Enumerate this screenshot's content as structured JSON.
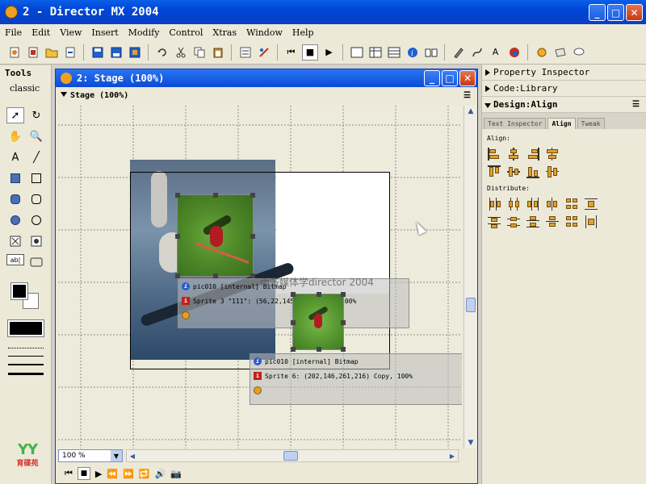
{
  "window": {
    "title": "2 - Director MX 2004",
    "min_label": "_",
    "max_label": "□",
    "close_label": "✕"
  },
  "menu": [
    "File",
    "Edit",
    "View",
    "Insert",
    "Modify",
    "Control",
    "Xtras",
    "Window",
    "Help"
  ],
  "toolbar": {
    "stop_glyph": "■",
    "rewind_glyph": "⏮",
    "play_glyph": "▶",
    "text_glyph": "A",
    "info_glyph": "i"
  },
  "tools": {
    "header": "Tools",
    "style": "classic",
    "text_tool_glyph": "A",
    "arrow_glyph": "➚",
    "rotate_glyph": "↻",
    "hand_glyph": "✋",
    "zoom_glyph": "🔍",
    "line_glyph": "╱",
    "field_glyph": "ab|",
    "logo_letters": "YY",
    "logo_text": "育碟苑"
  },
  "stage": {
    "title": "2: Stage (100%)",
    "subheader": "Stage (100%)",
    "zoom": "100 %",
    "watermark": "雨多媒体学director 2004",
    "card1": {
      "line1": "pic010 [internal] Bitmap",
      "line2": "Sprite 3 \"111\": (56,22,145,123) Copy, 100%"
    },
    "card2": {
      "line1": "pic010 [internal] Bitmap",
      "line2": "Sprite 6: (202,146,261,216) Copy, 100%"
    }
  },
  "right_panel": {
    "property_inspector": "Property Inspector",
    "code_library": "Code:Library",
    "design_align": "Design:Align",
    "tabs": [
      "Text Inspector",
      "Align",
      "Tweak"
    ],
    "align_label": "Align:",
    "distribute_label": "Distribute:"
  },
  "colors": {
    "title_bar": "#0a4ad6",
    "close_button": "#c43a14",
    "panel_bg": "#ece9d8"
  }
}
